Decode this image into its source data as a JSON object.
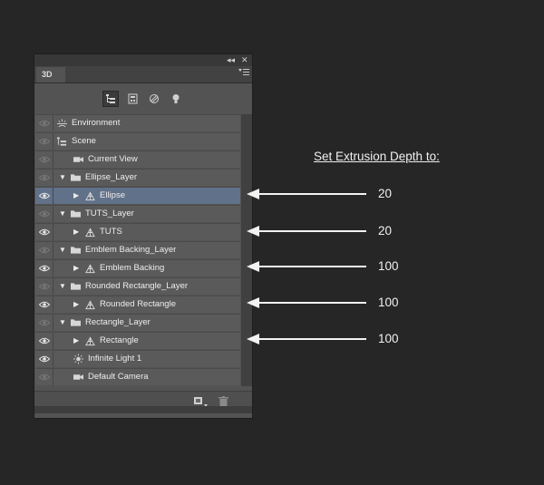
{
  "panel": {
    "title_buttons": {
      "collapse": "◂◂",
      "close": "✕"
    },
    "tab_label": "3D",
    "menu_icon": "panel-menu-icon",
    "toolbar_icons": [
      "scene-filter-icon",
      "mesh-filter-icon",
      "material-filter-icon",
      "light-filter-icon"
    ],
    "rows": [
      {
        "label": "Environment",
        "visible": false,
        "icon": "environment-icon",
        "indent": 0,
        "twisty": "",
        "selected": false
      },
      {
        "label": "Scene",
        "visible": false,
        "icon": "scene-icon",
        "indent": 0,
        "twisty": "",
        "selected": false
      },
      {
        "label": "Current View",
        "visible": false,
        "icon": "camera-icon",
        "indent": 1,
        "twisty": "",
        "selected": false
      },
      {
        "label": "Ellipse_Layer",
        "visible": false,
        "icon": "folder-icon",
        "indent": 0,
        "twisty": "down",
        "selected": false
      },
      {
        "label": "Ellipse",
        "visible": true,
        "icon": "mesh-icon",
        "indent": 1,
        "twisty": "right",
        "selected": true
      },
      {
        "label": "TUTS_Layer",
        "visible": false,
        "icon": "folder-icon",
        "indent": 0,
        "twisty": "down",
        "selected": false
      },
      {
        "label": "TUTS",
        "visible": true,
        "icon": "mesh-icon",
        "indent": 1,
        "twisty": "right",
        "selected": false
      },
      {
        "label": "Emblem Backing_Layer",
        "visible": false,
        "icon": "folder-icon",
        "indent": 0,
        "twisty": "down",
        "selected": false
      },
      {
        "label": "Emblem Backing",
        "visible": true,
        "icon": "mesh-icon",
        "indent": 1,
        "twisty": "right",
        "selected": false
      },
      {
        "label": "Rounded Rectangle_Layer",
        "visible": false,
        "icon": "folder-icon",
        "indent": 0,
        "twisty": "down",
        "selected": false
      },
      {
        "label": "Rounded Rectangle",
        "visible": true,
        "icon": "mesh-icon",
        "indent": 1,
        "twisty": "right",
        "selected": false
      },
      {
        "label": "Rectangle_Layer",
        "visible": false,
        "icon": "folder-icon",
        "indent": 0,
        "twisty": "down",
        "selected": false
      },
      {
        "label": "Rectangle",
        "visible": true,
        "icon": "mesh-icon",
        "indent": 1,
        "twisty": "right",
        "selected": false
      },
      {
        "label": "Infinite Light 1",
        "visible": true,
        "icon": "light-icon",
        "indent": 1,
        "twisty": "",
        "selected": false
      },
      {
        "label": "Default Camera",
        "visible": false,
        "icon": "camera-icon",
        "indent": 1,
        "twisty": "",
        "selected": false
      }
    ],
    "footer_icons": [
      "new-object-icon",
      "delete-icon"
    ]
  },
  "annotation": {
    "title": "Set Extrusion Depth to:",
    "values": [
      "20",
      "20",
      "100",
      "100",
      "100"
    ],
    "colors": {
      "arrow": "#f2f2f2",
      "selection": "#617189"
    }
  }
}
